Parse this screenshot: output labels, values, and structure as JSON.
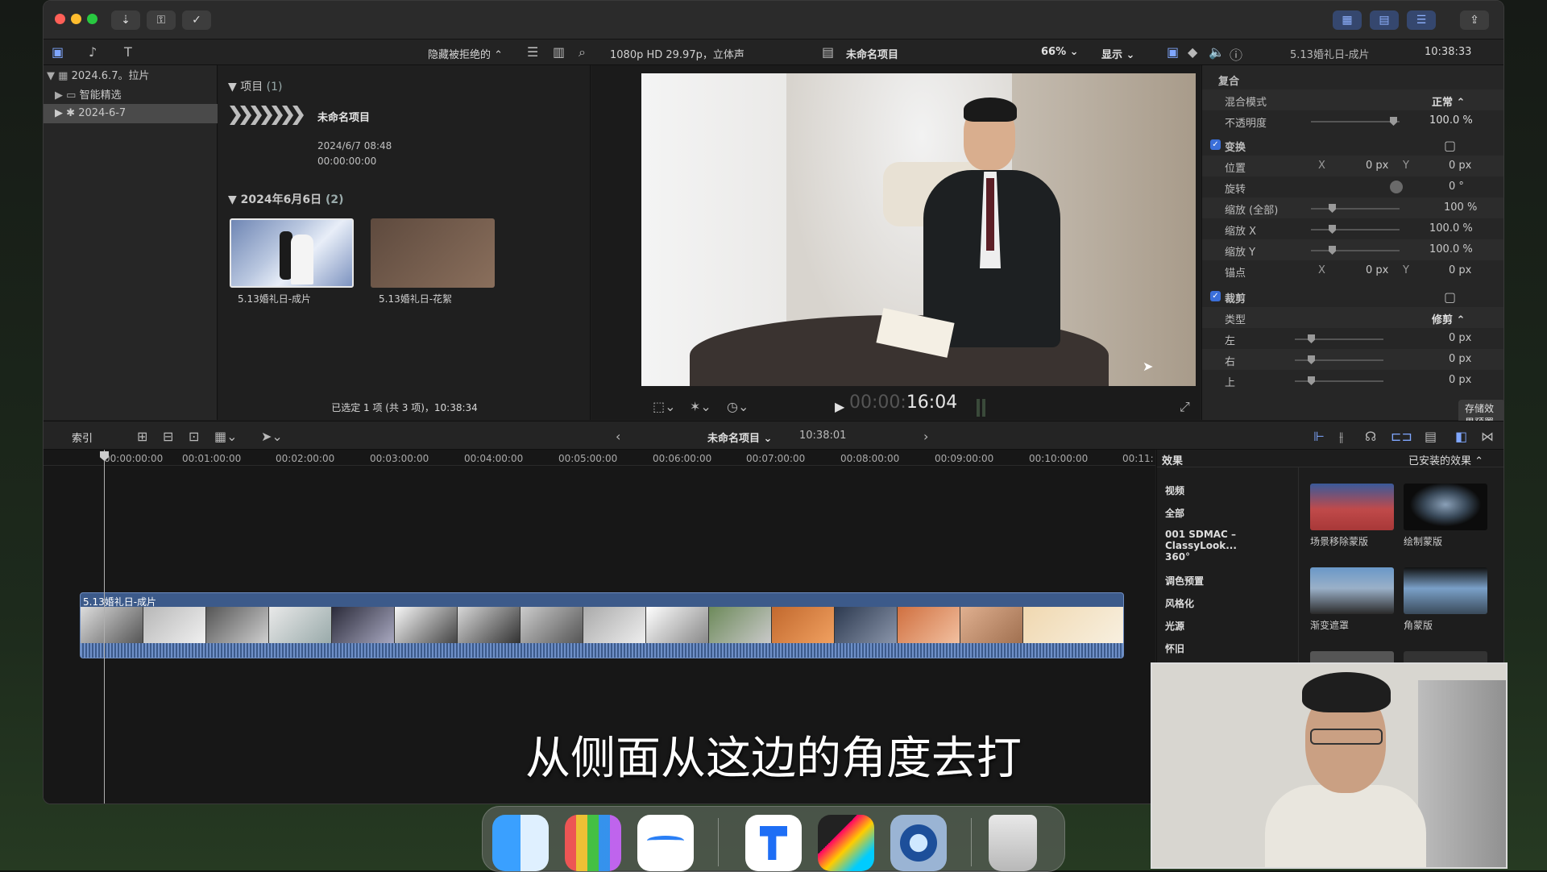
{
  "toolbar": {
    "filter_label": "隐藏被拒绝的",
    "format_label": "1080p HD 29.97p，立体声",
    "project_title": "未命名项目",
    "zoom": "66%",
    "display_label": "显示",
    "inspector_title": "5.13婚礼日-成片",
    "inspector_time": "10:38:33"
  },
  "library": {
    "items": [
      {
        "label": "2024.6.7。拉片"
      },
      {
        "label": "智能精选"
      },
      {
        "label": "2024-6-7"
      }
    ]
  },
  "browser": {
    "section_projects": "项目",
    "section_projects_count": "(1)",
    "project_name": "未命名项目",
    "project_date": "2024/6/7 08:48",
    "project_duration": "00:00:00:00",
    "section_date": "2024年6月6日",
    "section_date_count": "(2)",
    "clips": [
      {
        "label": "5.13婚礼日-成片"
      },
      {
        "label": "5.13婚礼日-花絮"
      }
    ],
    "status": "已选定 1 项 (共 3 项)，10:38:34"
  },
  "viewer": {
    "timecode_dim": "00:00:",
    "timecode_bright": "16:04"
  },
  "inspector": {
    "compositing_header": "复合",
    "blend_mode_label": "混合模式",
    "blend_mode_value": "正常",
    "opacity_label": "不透明度",
    "opacity_value": "100.0",
    "transform_label": "变换",
    "position_label": "位置",
    "position_x": "0",
    "position_y": "0",
    "rotation_label": "旋转",
    "rotation_value": "0",
    "scale_all_label": "缩放 (全部)",
    "scale_all_value": "100",
    "scale_x_label": "缩放 X",
    "scale_x_value": "100.0",
    "scale_y_label": "缩放 Y",
    "scale_y_value": "100.0",
    "anchor_label": "锚点",
    "anchor_x": "0",
    "anchor_y": "0",
    "crop_label": "裁剪",
    "crop_type_label": "类型",
    "crop_type_value": "修剪",
    "left_label": "左",
    "left_value": "0",
    "right_label": "右",
    "right_value": "0",
    "top_label": "上",
    "top_value": "0",
    "unit_px": "px",
    "unit_pct": "%",
    "unit_deg": "°",
    "axis_x": "X",
    "axis_y": "Y",
    "save_preset": "存储效果预置"
  },
  "timeline_bar": {
    "index_label": "索引",
    "project_title": "未命名项目",
    "duration": "10:38:01"
  },
  "timeline": {
    "ruler": [
      "00:00:00:00",
      "00:01:00:00",
      "00:02:00:00",
      "00:03:00:00",
      "00:04:00:00",
      "00:05:00:00",
      "00:06:00:00",
      "00:07:00:00",
      "00:08:00:00",
      "00:09:00:00",
      "00:10:00:00",
      "00:11:"
    ],
    "clip_label": "5.13婚礼日-成片"
  },
  "effects": {
    "header": "效果",
    "installed": "已安装的效果",
    "categories": [
      "视频",
      "全部",
      "001 SDMAC – ClassyLook...",
      "360°",
      "调色预置",
      "风格化",
      "光源",
      "怀旧"
    ],
    "items": [
      {
        "label": "场景移除蒙版"
      },
      {
        "label": "绘制蒙版"
      },
      {
        "label": "渐变遮罩"
      },
      {
        "label": "角蒙版"
      }
    ]
  },
  "subtitle": "从侧面从这边的角度去打",
  "colors": {
    "accent": "#3b6fd9",
    "clip_blue": "#3c5a8a",
    "playhead": "#b0b0b0"
  }
}
